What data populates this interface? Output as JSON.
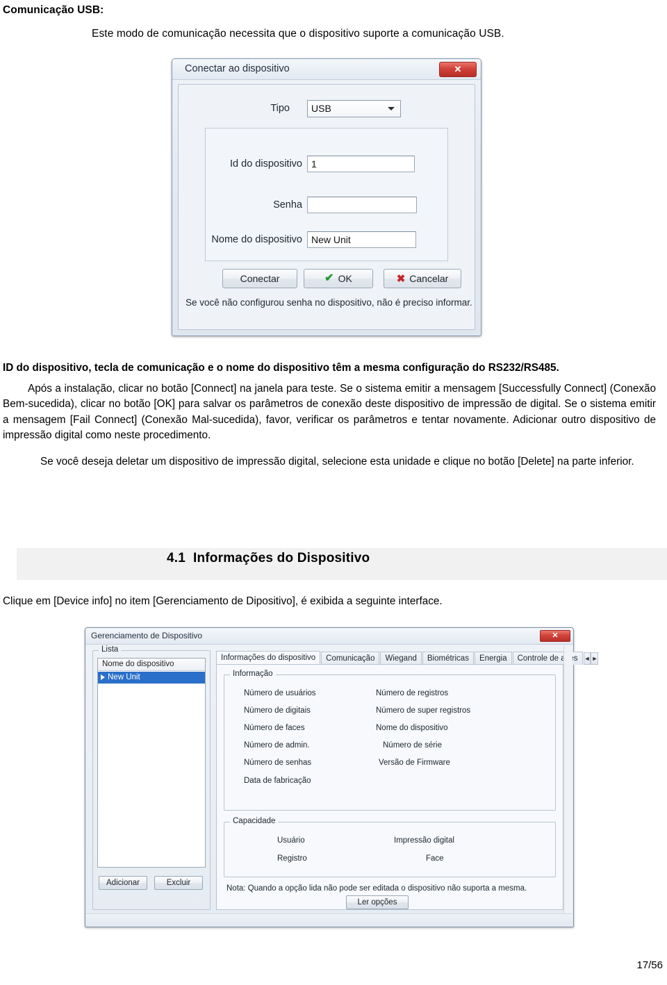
{
  "document": {
    "heading_usb": "Comunicação USB:",
    "intro": "Este modo de comunicação necessita que o dispositivo suporte a comunicação USB.",
    "paragraph_1": "ID do dispositivo, tecla de comunicação e o nome do dispositivo têm a mesma configuração do RS232/RS485.",
    "paragraph_2": "Após a instalação, clicar no botão [Connect] na janela para teste. Se o sistema emitir a mensagem [Successfully Connect] (Conexão Bem-sucedida), clicar no botão [OK] para salvar os parâmetros de conexão deste dispositivo de impressão de digital. Se o sistema emitir a mensagem [Fail Connect] (Conexão Mal-sucedida), favor, verificar os parâmetros e tentar novamente. Adicionar outro dispositivo de impressão digital como neste procedimento.",
    "paragraph_3": "Se você deseja deletar um dispositivo de impressão digital, selecione esta unidade e clique no botão [Delete] na parte inferior.",
    "section_number": "4.1",
    "section_title": "Informações do Dispositivo",
    "clique_line": "Clique em [Device info] no item [Gerenciamento de Dipositivo], é exibida a seguinte interface.",
    "page_number": "17/56"
  },
  "dialog_connect": {
    "title": "Conectar ao dispositivo",
    "close_label": "✕",
    "label_tipo": "Tipo",
    "value_tipo": "USB",
    "label_id": "Id do dispositivo",
    "value_id": "1",
    "label_senha": "Senha",
    "value_senha": "",
    "label_nome": "Nome do dispositivo",
    "value_nome": "New Unit",
    "btn_conectar": "Conectar",
    "btn_ok": "OK",
    "btn_cancelar": "Cancelar",
    "note": "Se você não configurou senha no dispositivo, não é preciso informar."
  },
  "dialog_device_mgmt": {
    "title": "Gerenciamento de Dispositivo",
    "close_label": "✕",
    "list_group_caption": "Lista",
    "list_header": "Nome do dispositivo",
    "list_selected_item": "New Unit",
    "tabs": [
      "Informações do dispositivo",
      "Comunicação",
      "Wiegand",
      "Biométricas",
      "Energia",
      "Controle de aces"
    ],
    "tab_scroll_left": "◄",
    "tab_scroll_right": "►",
    "group_info_caption": "Informação",
    "info_labels_left": [
      "Número de usuários",
      "Número de digitais",
      "Número de faces",
      "Número de admin.",
      "Número de senhas",
      "Data de fabricação"
    ],
    "info_labels_right": [
      "Número de registros",
      "Número de super registros",
      "Nome do dispositivo",
      "Número de série",
      "Versão de Firmware"
    ],
    "group_capacity_caption": "Capacidade",
    "capacity_labels_left": [
      "Usuário",
      "Registro"
    ],
    "capacity_labels_right": [
      "Impressão digital",
      "Face"
    ],
    "btn_adicionar": "Adicionar",
    "btn_excluir": "Excluir",
    "note": "Nota: Quando a opção lida não pode ser editada o dispositivo não suporta a mesma.",
    "btn_ler_opcoes": "Ler opções"
  }
}
